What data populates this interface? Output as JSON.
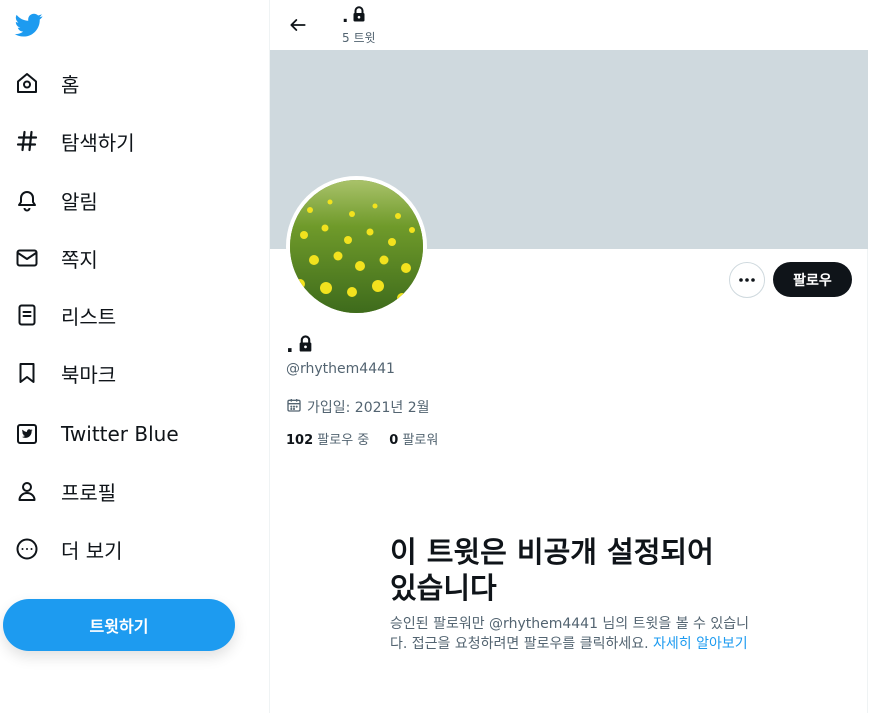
{
  "nav": {
    "logo": "twitter-bird-icon",
    "items": [
      {
        "label": "홈",
        "icon": "home-icon"
      },
      {
        "label": "탐색하기",
        "icon": "hashtag-icon"
      },
      {
        "label": "알림",
        "icon": "bell-icon"
      },
      {
        "label": "쪽지",
        "icon": "envelope-icon"
      },
      {
        "label": "리스트",
        "icon": "list-icon"
      },
      {
        "label": "북마크",
        "icon": "bookmark-icon"
      },
      {
        "label": "Twitter Blue",
        "icon": "twitter-blue-icon"
      },
      {
        "label": "프로필",
        "icon": "profile-icon"
      },
      {
        "label": "더 보기",
        "icon": "more-circle-icon"
      }
    ],
    "tweet_button": "트윗하기"
  },
  "header": {
    "name": ".",
    "tweet_count": "5 트윗"
  },
  "profile": {
    "name": ".",
    "handle": "@rhythem4441",
    "joined": "가입일: 2021년 2월",
    "following_count": "102",
    "following_label": "팔로우 중",
    "followers_count": "0",
    "followers_label": "팔로워",
    "follow_button": "팔로우"
  },
  "protected": {
    "title": "이 트윗은 비공개 설정되어 있습니다",
    "description": "승인된 팔로워만 @rhythem4441 님의 트윗을 볼 수 있습니다. 접근을 요청하려면 팔로우를 클릭하세요.",
    "link": "자세히 알아보기"
  },
  "colors": {
    "accent": "#1d9bf0",
    "banner": "#cfd9de",
    "text": "#0f1419",
    "secondary": "#536471"
  }
}
